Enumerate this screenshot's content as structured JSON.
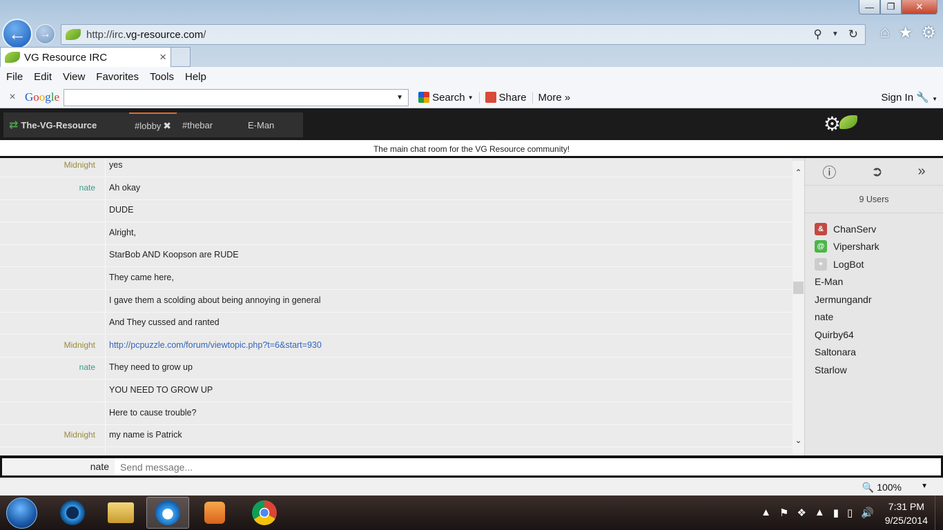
{
  "browser": {
    "url_prefix": "http://irc.",
    "url_domain": "vg-resource.com",
    "url_suffix": "/",
    "tab_title": "VG Resource IRC",
    "tab_close": "×",
    "window_buttons": [
      "—",
      "❐",
      "✕"
    ],
    "menu": [
      "File",
      "Edit",
      "View",
      "Favorites",
      "Tools",
      "Help"
    ],
    "nav_icons": [
      "back-arrow-icon",
      "forward-arrow-icon",
      "home-icon",
      "star-icon",
      "gear-icon"
    ]
  },
  "google_toolbar": {
    "close": "×",
    "logo_letters": [
      "G",
      "o",
      "o",
      "g",
      "l",
      "e"
    ],
    "search_value": "",
    "search_label": "Search",
    "share_label": "Share",
    "more_label": "More »",
    "signin_label": "Sign In",
    "colors": {
      "google_blue": "#1a5fd3",
      "google_red": "#d8362c",
      "share_red": "#d94a38"
    }
  },
  "irc": {
    "server_tab": "The-VG-Resource",
    "channel_tabs": [
      {
        "label": "#lobby",
        "active": true,
        "close": "✖"
      },
      {
        "label": "#thebar",
        "active": false
      },
      {
        "label": "E-Man",
        "active": false
      }
    ],
    "topic": "The main chat room for the VG Resource community!",
    "messages": [
      {
        "nick": "Midnight",
        "text": "yes",
        "nick_color": "#9a8a3a",
        "link": false
      },
      {
        "nick": "nate",
        "text": "Ah okay",
        "nick_color": "#3a9a8a",
        "link": false
      },
      {
        "nick": "",
        "text": "DUDE",
        "nick_color": "#3a9a8a",
        "link": false
      },
      {
        "nick": "",
        "text": "Alright,",
        "nick_color": "#3a9a8a",
        "link": false
      },
      {
        "nick": "",
        "text": "StarBob AND Koopson are RUDE",
        "nick_color": "#3a9a8a",
        "link": false
      },
      {
        "nick": "",
        "text": "They came here,",
        "nick_color": "#3a9a8a",
        "link": false
      },
      {
        "nick": "",
        "text": "I gave them a scolding about being annoying in general",
        "nick_color": "#3a9a8a",
        "link": false
      },
      {
        "nick": "",
        "text": "And They cussed and ranted",
        "nick_color": "#3a9a8a",
        "link": false
      },
      {
        "nick": "Midnight",
        "text": "http://pcpuzzle.com/forum/viewtopic.php?t=6&start=930",
        "nick_color": "#9a8a3a",
        "link": true
      },
      {
        "nick": "nate",
        "text": "They need to grow up",
        "nick_color": "#3a9a8a",
        "link": false
      },
      {
        "nick": "",
        "text": "YOU NEED TO GROW UP",
        "nick_color": "#3a9a8a",
        "link": false
      },
      {
        "nick": "",
        "text": "Here to cause trouble?",
        "nick_color": "#3a9a8a",
        "link": false
      },
      {
        "nick": "Midnight",
        "text": "my name is Patrick",
        "nick_color": "#9a8a3a",
        "link": false
      },
      {
        "nick": "",
        "text": "",
        "nick_color": "#3a9a8a",
        "link": false
      }
    ],
    "sidebar_icons": [
      "info-icon",
      "leave-channel-icon",
      "collapse-icon"
    ],
    "user_count": "9 Users",
    "users": [
      {
        "name": "ChanServ",
        "mode": "&",
        "mode_color": "#c24a43"
      },
      {
        "name": "Vipershark",
        "mode": "@",
        "mode_color": "#4cb54a"
      },
      {
        "name": "LogBot",
        "mode": "+",
        "mode_color": "#cccccc"
      },
      {
        "name": "E-Man",
        "mode": "",
        "mode_color": ""
      },
      {
        "name": "Jermungandr",
        "mode": "",
        "mode_color": ""
      },
      {
        "name": "nate",
        "mode": "",
        "mode_color": ""
      },
      {
        "name": "Quirby64",
        "mode": "",
        "mode_color": ""
      },
      {
        "name": "Saltonara",
        "mode": "",
        "mode_color": ""
      },
      {
        "name": "Starlow",
        "mode": "",
        "mode_color": ""
      }
    ],
    "input_nick": "nate",
    "input_placeholder": "Send message...",
    "input_value": ""
  },
  "status": {
    "zoom": "100%"
  },
  "taskbar": {
    "time": "7:31 PM",
    "date": "9/25/2014",
    "apps": [
      "windows-start-icon",
      "refresh-app-icon",
      "file-explorer-icon",
      "internet-explorer-icon",
      "media-player-icon",
      "chrome-icon"
    ]
  }
}
